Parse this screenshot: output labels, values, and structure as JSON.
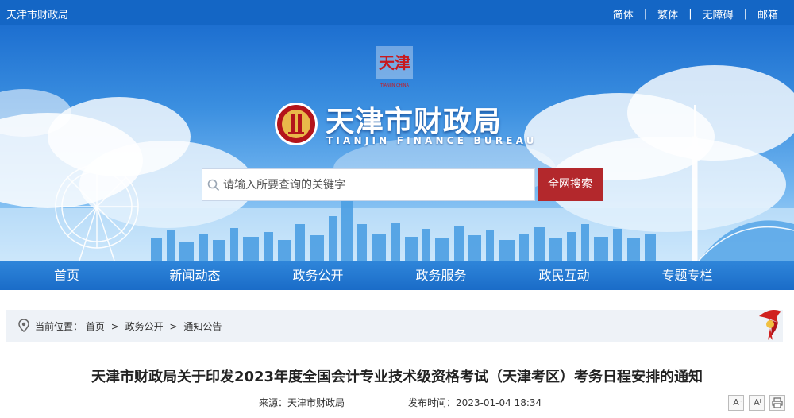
{
  "topbar": {
    "site_name": "天津市财政局",
    "links": [
      {
        "label": "简体"
      },
      {
        "label": "繁体"
      },
      {
        "label": "无障碍"
      },
      {
        "label": "邮箱"
      }
    ],
    "separator": "|"
  },
  "banner": {
    "seal_text": "天津",
    "seal_caption": "TIANJIN CHINA",
    "logo_title": "天津市财政局",
    "logo_subtitle": "TIANJIN FINANCE BUREAU"
  },
  "search": {
    "placeholder": "请输入所要查询的关键字",
    "button_label": "全网搜索"
  },
  "nav": {
    "items": [
      {
        "label": "首页"
      },
      {
        "label": "新闻动态"
      },
      {
        "label": "政务公开"
      },
      {
        "label": "政务服务"
      },
      {
        "label": "政民互动"
      },
      {
        "label": "专题专栏"
      }
    ]
  },
  "breadcrumb": {
    "prefix": "当前位置：",
    "items": [
      "首页",
      "政务公开",
      "通知公告"
    ],
    "separator": ">"
  },
  "article": {
    "title": "天津市财政局关于印发2023年度全国会计专业技术级资格考试（天津考区）考务日程安排的通知",
    "source_label": "来源：",
    "source_value": "天津市财政局",
    "date_label": "发布时间：",
    "date_value": "2023-01-04 18:34"
  },
  "tools": {
    "decrease_font": "A",
    "increase_font": "A",
    "decrease_mark": "-",
    "increase_mark": "+"
  },
  "colors": {
    "topbar": "#1466c5",
    "nav": "#1a6cc8",
    "search_button": "#b3282c",
    "breadcrumb_bg": "#eef2f7"
  },
  "icons": {
    "search": "search-icon",
    "location": "location-pin-icon",
    "print": "print-icon",
    "ribbon": "ribbon-decoration-icon"
  }
}
